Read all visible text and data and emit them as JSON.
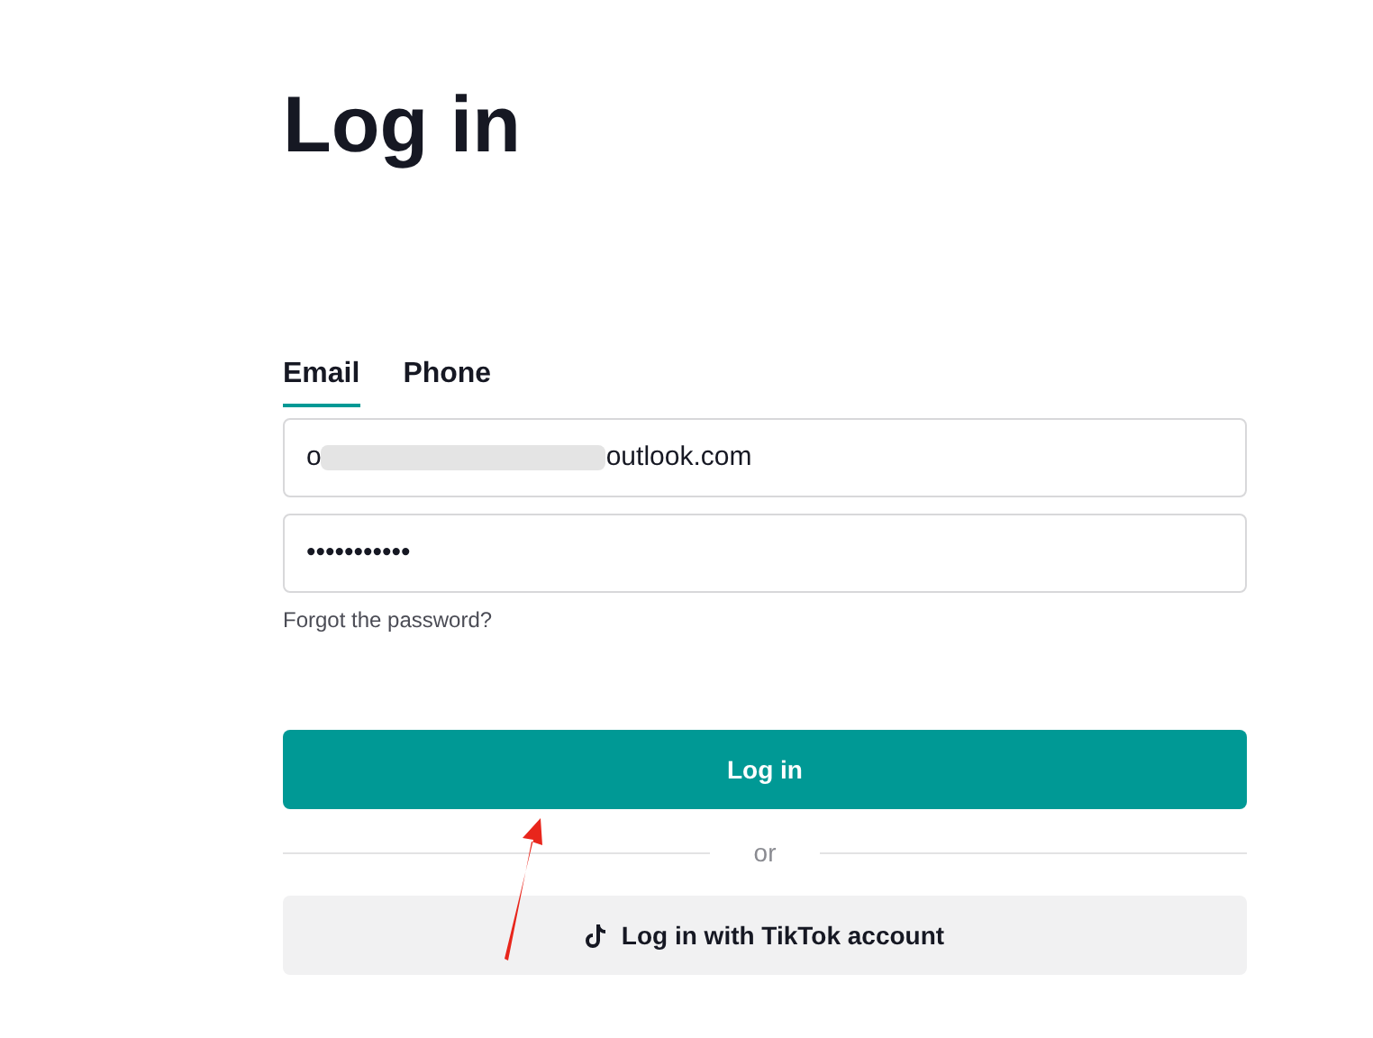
{
  "title": "Log in",
  "tabs": [
    {
      "label": "Email",
      "selected": true
    },
    {
      "label": "Phone",
      "selected": false
    }
  ],
  "email": {
    "value_start": "o",
    "value_end": "outlook.com",
    "redacted": true
  },
  "password": {
    "value": "•••••••••••"
  },
  "forgot_link": "Forgot the password?",
  "login_button": "Log in",
  "divider": "or",
  "tiktok_button": "Log in with TikTok account",
  "annotation": {
    "kind": "arrow"
  }
}
